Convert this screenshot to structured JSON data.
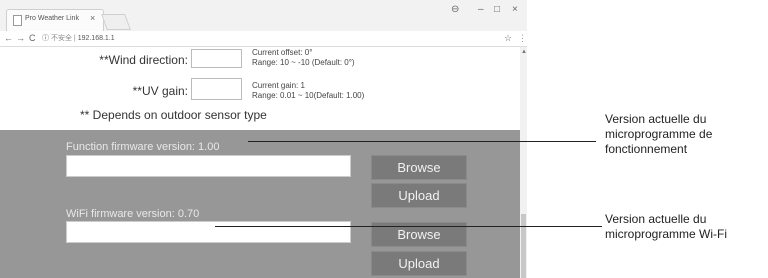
{
  "browser": {
    "tab_title": "Pro Weather Link",
    "tab_close": "×",
    "window_controls": {
      "account": "⊖",
      "minimize": "–",
      "maximize": "□",
      "close": "×"
    },
    "nav": {
      "back": "←",
      "forward": "→",
      "reload": "C"
    },
    "address": {
      "info": "ⓘ",
      "security_text": "不安全",
      "separator": "|",
      "url": "192.168.1.1"
    },
    "bookmark_star": "☆",
    "menu": "⋮",
    "scroll_up": "▲"
  },
  "settings": {
    "wind_direction": {
      "label": "**Wind direction:",
      "value": "",
      "hint_line1": "Current offset: 0°",
      "hint_line2": "Range: 10 ~ -10 (Default: 0°)"
    },
    "uv_gain": {
      "label": "**UV gain:",
      "value": "",
      "hint_line1": "Current gain: 1",
      "hint_line2": "Range: 0.01 ~ 10(Default: 1.00)"
    },
    "note": "** Depends on outdoor sensor type"
  },
  "firmware": {
    "function": {
      "label": "Function firmware version: 1.00",
      "file_value": "",
      "browse_label": "Browse",
      "upload_label": "Upload"
    },
    "wifi": {
      "label": "WiFi firmware version: 0.70",
      "file_value": "",
      "browse_label": "Browse",
      "upload_label": "Upload"
    }
  },
  "callouts": {
    "function": {
      "line1": "Version actuelle du",
      "line2": "microprogramme de",
      "line3": "fonctionnement"
    },
    "wifi": {
      "line1": "Version actuelle du",
      "line2": "microprogramme Wi-Fi"
    }
  }
}
